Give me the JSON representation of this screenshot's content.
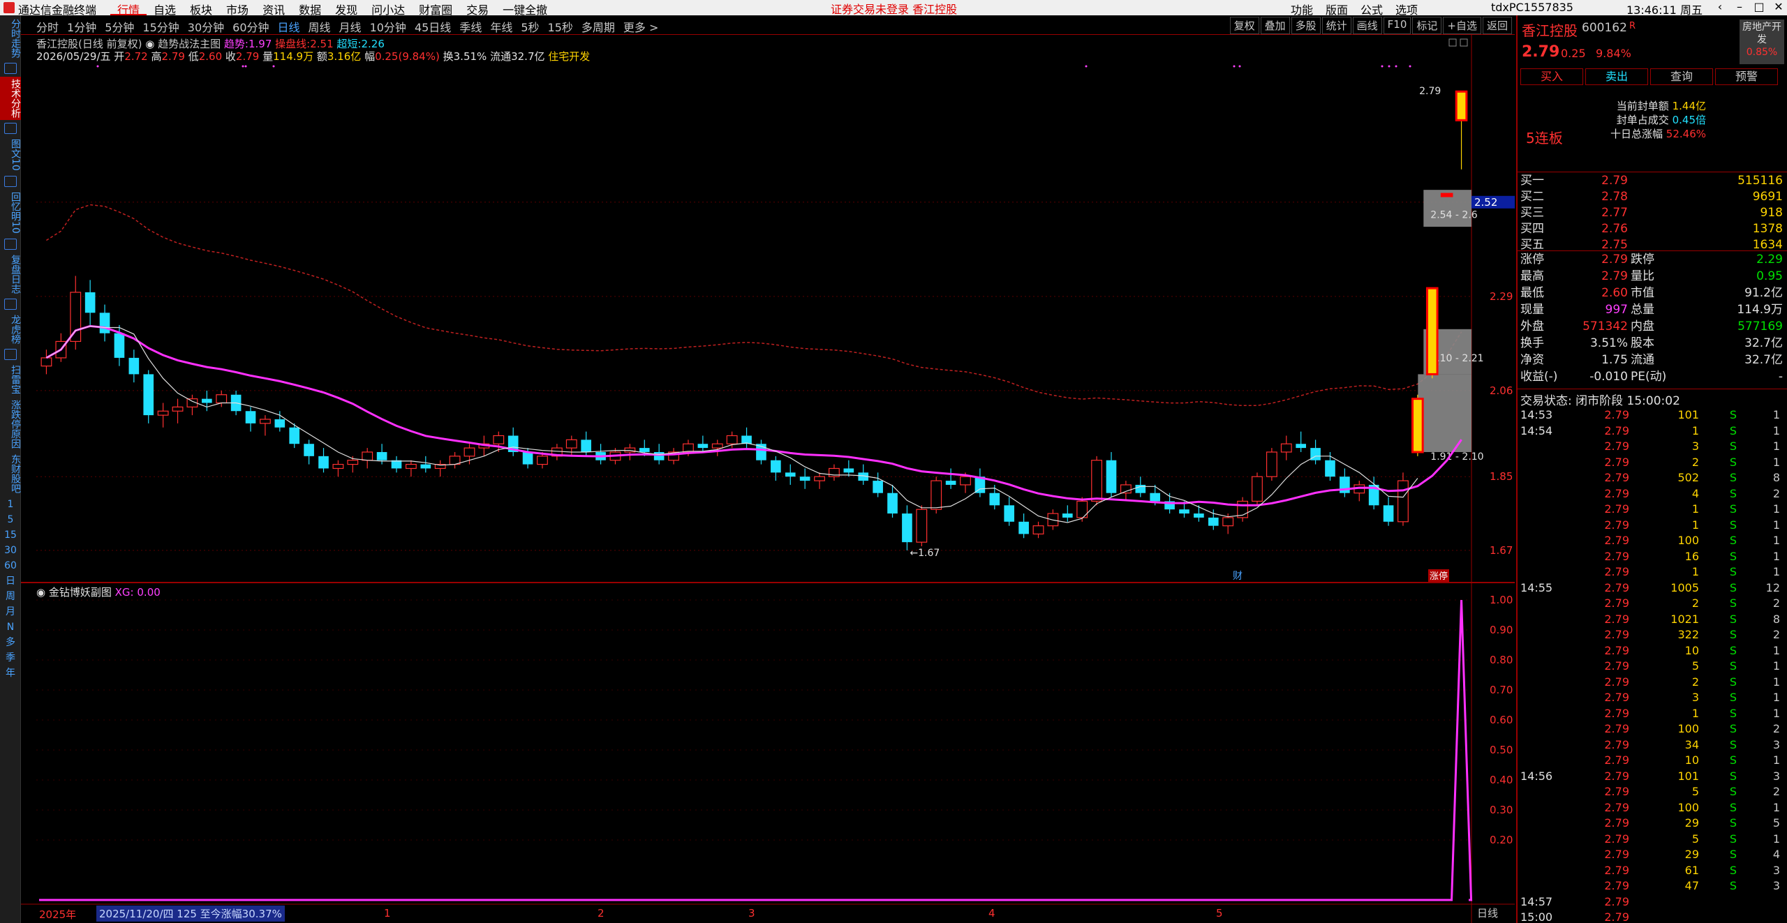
{
  "app": {
    "name": "通达信金融终端"
  },
  "menu": {
    "items": [
      "行情",
      "自选",
      "板块",
      "市场",
      "资讯",
      "数据",
      "发现",
      "问小达",
      "财富圈",
      "交易",
      "一键全撤"
    ],
    "active": "行情",
    "notice": "证券交易未登录  香江控股",
    "right_items": [
      "功能",
      "版面",
      "公式",
      "选项"
    ],
    "client_id": "tdxPC1557835",
    "time": "13:46:11 周五"
  },
  "left_toolbar": {
    "tabs": [
      "分时走势",
      "技术分析",
      "图文10",
      "回忆明10",
      "复盘日志",
      "龙虎榜",
      "扫雷宝",
      "涨跌停原因",
      "东财股吧"
    ],
    "active": "技术分析",
    "periods": [
      "1",
      "5",
      "15",
      "30",
      "60",
      "日",
      "周",
      "月",
      "N",
      "多",
      "季",
      "年"
    ]
  },
  "period_bar": {
    "items": [
      "分时",
      "1分钟",
      "5分钟",
      "15分钟",
      "30分钟",
      "60分钟",
      "日线",
      "周线",
      "月线",
      "10分钟",
      "45日线",
      "季线",
      "年线",
      "5秒",
      "15秒",
      "多周期",
      "更多 >"
    ],
    "selected": "日线",
    "buttons": [
      "复权",
      "叠加",
      "多股",
      "统计",
      "画线",
      "F10",
      "标记",
      "+自选",
      "返回"
    ]
  },
  "main_chart": {
    "title": "香江控股(日线 前复权)",
    "indicator_name": "趋势战法主图",
    "ind_trend_label": "趋势:",
    "ind_trend_val": "1.97",
    "ind_ctrl_label": "操盘线:",
    "ind_ctrl_val": "2.51",
    "ind_short_label": "超短:",
    "ind_short_val": "2.26",
    "date": "2026/05/29/五",
    "open_label": "开",
    "open": "2.72",
    "high_label": "高",
    "high": "2.79",
    "low_label": "低",
    "low": "2.60",
    "close_label": "收",
    "close": "2.79",
    "vol_label": "量",
    "vol": "114.9万",
    "amt_label": "额",
    "amt": "3.16亿",
    "chg_label": "幅",
    "chg": "0.25(9.84%)",
    "turn_label": "换",
    "turn": "3.51%",
    "float_label": "流通",
    "float": "32.7亿",
    "sector": "住宅开发",
    "price_ticks": [
      "2.52",
      "2.29",
      "2.06",
      "1.85",
      "1.67"
    ],
    "current_price_tag": "2.52",
    "label_high": "2.79",
    "label_low": "1.67",
    "zone_labels": [
      "2.54 - 2.6",
      "2.10 - 2.21",
      "1.91 - 2.10"
    ],
    "tag_cai": "财",
    "tag_zt": "涨停"
  },
  "sub_chart": {
    "title": "金钻博妖副图",
    "val_label": "XG:",
    "val": "0.00",
    "y_ticks": [
      "1.00",
      "0.90",
      "0.80",
      "0.70",
      "0.60",
      "0.50",
      "0.40",
      "0.30",
      "0.20"
    ]
  },
  "date_axis": {
    "year": "2025年",
    "range": "2025/11/20/四 125 至今涨幅30.37%",
    "months": [
      "1",
      "2",
      "3",
      "4",
      "5"
    ],
    "tab": "日线"
  },
  "chart_data": {
    "type": "candlestick",
    "title": "香江控股(日线 前复权)",
    "ylim": [
      1.6,
      2.85
    ],
    "candles": [
      [
        2.12,
        2.16,
        2.1,
        2.14
      ],
      [
        2.14,
        2.2,
        2.13,
        2.18
      ],
      [
        2.18,
        2.34,
        2.16,
        2.3
      ],
      [
        2.3,
        2.33,
        2.22,
        2.25
      ],
      [
        2.25,
        2.27,
        2.18,
        2.2
      ],
      [
        2.2,
        2.22,
        2.12,
        2.14
      ],
      [
        2.14,
        2.16,
        2.08,
        2.1
      ],
      [
        2.1,
        2.11,
        1.98,
        2.0
      ],
      [
        2.0,
        2.03,
        1.97,
        2.01
      ],
      [
        2.01,
        2.04,
        1.98,
        2.02
      ],
      [
        2.02,
        2.05,
        2.0,
        2.04
      ],
      [
        2.04,
        2.06,
        2.01,
        2.03
      ],
      [
        2.03,
        2.06,
        2.02,
        2.05
      ],
      [
        2.05,
        2.06,
        2.0,
        2.01
      ],
      [
        2.01,
        2.02,
        1.96,
        1.98
      ],
      [
        1.98,
        2.0,
        1.95,
        1.99
      ],
      [
        1.99,
        2.01,
        1.96,
        1.97
      ],
      [
        1.97,
        1.98,
        1.92,
        1.93
      ],
      [
        1.93,
        1.94,
        1.88,
        1.9
      ],
      [
        1.9,
        1.92,
        1.86,
        1.87
      ],
      [
        1.87,
        1.89,
        1.85,
        1.88
      ],
      [
        1.88,
        1.9,
        1.86,
        1.89
      ],
      [
        1.89,
        1.92,
        1.87,
        1.91
      ],
      [
        1.91,
        1.93,
        1.88,
        1.89
      ],
      [
        1.89,
        1.9,
        1.86,
        1.87
      ],
      [
        1.87,
        1.89,
        1.85,
        1.88
      ],
      [
        1.88,
        1.9,
        1.86,
        1.87
      ],
      [
        1.87,
        1.89,
        1.85,
        1.88
      ],
      [
        1.88,
        1.91,
        1.87,
        1.9
      ],
      [
        1.9,
        1.93,
        1.88,
        1.92
      ],
      [
        1.92,
        1.95,
        1.9,
        1.93
      ],
      [
        1.93,
        1.96,
        1.91,
        1.95
      ],
      [
        1.95,
        1.97,
        1.9,
        1.91
      ],
      [
        1.91,
        1.92,
        1.87,
        1.88
      ],
      [
        1.88,
        1.91,
        1.87,
        1.9
      ],
      [
        1.9,
        1.93,
        1.89,
        1.92
      ],
      [
        1.92,
        1.95,
        1.9,
        1.94
      ],
      [
        1.94,
        1.96,
        1.9,
        1.91
      ],
      [
        1.91,
        1.93,
        1.88,
        1.89
      ],
      [
        1.89,
        1.92,
        1.88,
        1.91
      ],
      [
        1.91,
        1.93,
        1.89,
        1.92
      ],
      [
        1.92,
        1.94,
        1.9,
        1.91
      ],
      [
        1.91,
        1.93,
        1.88,
        1.89
      ],
      [
        1.89,
        1.92,
        1.88,
        1.91
      ],
      [
        1.91,
        1.94,
        1.9,
        1.93
      ],
      [
        1.93,
        1.95,
        1.91,
        1.92
      ],
      [
        1.92,
        1.94,
        1.9,
        1.93
      ],
      [
        1.93,
        1.96,
        1.92,
        1.95
      ],
      [
        1.95,
        1.97,
        1.92,
        1.93
      ],
      [
        1.93,
        1.94,
        1.88,
        1.89
      ],
      [
        1.89,
        1.9,
        1.84,
        1.86
      ],
      [
        1.86,
        1.88,
        1.83,
        1.85
      ],
      [
        1.85,
        1.87,
        1.82,
        1.84
      ],
      [
        1.84,
        1.86,
        1.82,
        1.85
      ],
      [
        1.85,
        1.88,
        1.84,
        1.87
      ],
      [
        1.87,
        1.89,
        1.85,
        1.86
      ],
      [
        1.86,
        1.88,
        1.83,
        1.84
      ],
      [
        1.84,
        1.86,
        1.8,
        1.81
      ],
      [
        1.81,
        1.83,
        1.75,
        1.76
      ],
      [
        1.76,
        1.78,
        1.67,
        1.69
      ],
      [
        1.69,
        1.78,
        1.68,
        1.77
      ],
      [
        1.77,
        1.85,
        1.76,
        1.84
      ],
      [
        1.84,
        1.87,
        1.82,
        1.83
      ],
      [
        1.83,
        1.86,
        1.81,
        1.85
      ],
      [
        1.85,
        1.87,
        1.8,
        1.81
      ],
      [
        1.81,
        1.83,
        1.77,
        1.78
      ],
      [
        1.78,
        1.8,
        1.73,
        1.74
      ],
      [
        1.74,
        1.76,
        1.7,
        1.71
      ],
      [
        1.71,
        1.74,
        1.7,
        1.73
      ],
      [
        1.73,
        1.77,
        1.72,
        1.76
      ],
      [
        1.76,
        1.78,
        1.74,
        1.75
      ],
      [
        1.75,
        1.8,
        1.74,
        1.79
      ],
      [
        1.79,
        1.9,
        1.78,
        1.89
      ],
      [
        1.89,
        1.91,
        1.8,
        1.81
      ],
      [
        1.81,
        1.84,
        1.79,
        1.83
      ],
      [
        1.83,
        1.85,
        1.8,
        1.81
      ],
      [
        1.81,
        1.83,
        1.78,
        1.79
      ],
      [
        1.79,
        1.81,
        1.76,
        1.77
      ],
      [
        1.77,
        1.79,
        1.75,
        1.76
      ],
      [
        1.76,
        1.78,
        1.74,
        1.75
      ],
      [
        1.75,
        1.77,
        1.72,
        1.73
      ],
      [
        1.73,
        1.76,
        1.71,
        1.75
      ],
      [
        1.75,
        1.8,
        1.74,
        1.79
      ],
      [
        1.79,
        1.86,
        1.78,
        1.85
      ],
      [
        1.85,
        1.92,
        1.84,
        1.91
      ],
      [
        1.91,
        1.95,
        1.89,
        1.93
      ],
      [
        1.93,
        1.96,
        1.91,
        1.92
      ],
      [
        1.92,
        1.94,
        1.88,
        1.89
      ],
      [
        1.89,
        1.91,
        1.84,
        1.85
      ],
      [
        1.85,
        1.87,
        1.8,
        1.81
      ],
      [
        1.81,
        1.84,
        1.79,
        1.83
      ],
      [
        1.83,
        1.85,
        1.77,
        1.78
      ],
      [
        1.78,
        1.8,
        1.73,
        1.74
      ],
      [
        1.74,
        1.86,
        1.73,
        1.84
      ],
      [
        1.91,
        2.05,
        1.9,
        2.04
      ],
      [
        2.1,
        2.31,
        2.09,
        2.31
      ],
      [
        2.54,
        2.54,
        2.54,
        2.54
      ],
      [
        2.72,
        2.79,
        2.6,
        2.79
      ]
    ],
    "series": [
      {
        "name": "操盘线",
        "values_hint": "magenta moving average"
      },
      {
        "name": "超短",
        "values_hint": "white short average"
      }
    ],
    "sub_series": {
      "name": "XG",
      "range": [
        0,
        1
      ],
      "spike_at_end": 1.0
    }
  },
  "right_panel": {
    "name": "香江控股",
    "code": "600162",
    "r_mark": "R",
    "price": "2.79",
    "change": "0.25",
    "change_pct": "9.84%",
    "sector_name": "房地产开发",
    "sector_pct": "0.85%",
    "buttons": [
      "买入",
      "卖出",
      "查询",
      "预警"
    ],
    "seal_amount_label": "当前封单额",
    "seal_amount": "1.44亿",
    "seal_ratio_label": "封单占成交",
    "seal_ratio": "0.45倍",
    "ten_day_label": "十日总涨幅",
    "ten_day": "52.46%",
    "lianban": "5连板",
    "bids": [
      {
        "k": "买一",
        "p": "2.79",
        "v": "515116"
      },
      {
        "k": "买二",
        "p": "2.78",
        "v": "9691"
      },
      {
        "k": "买三",
        "p": "2.77",
        "v": "918"
      },
      {
        "k": "买四",
        "p": "2.76",
        "v": "1378"
      },
      {
        "k": "买五",
        "p": "2.75",
        "v": "1634"
      }
    ],
    "stats": [
      {
        "k1": "涨停",
        "v1": "2.79",
        "c1": "red",
        "k2": "跌停",
        "v2": "2.29",
        "c2": "grn"
      },
      {
        "k1": "最高",
        "v1": "2.79",
        "c1": "red",
        "k2": "量比",
        "v2": "0.95",
        "c2": "grn"
      },
      {
        "k1": "最低",
        "v1": "2.60",
        "c1": "red",
        "k2": "市值",
        "v2": "91.2亿",
        "c2": "wh"
      },
      {
        "k1": "现量",
        "v1": "997",
        "c1": "mag",
        "k2": "总量",
        "v2": "114.9万",
        "c2": "wh"
      },
      {
        "k1": "外盘",
        "v1": "571342",
        "c1": "red",
        "k2": "内盘",
        "v2": "577169",
        "c2": "grn"
      },
      {
        "k1": "换手",
        "v1": "3.51%",
        "c1": "wh",
        "k2": "股本",
        "v2": "32.7亿",
        "c2": "wh"
      },
      {
        "k1": "净资",
        "v1": "1.75",
        "c1": "wh",
        "k2": "流通",
        "v2": "32.7亿",
        "c2": "wh"
      },
      {
        "k1": "收益(-)",
        "v1": "-0.010",
        "c1": "wh",
        "k2": "PE(动)",
        "v2": "-",
        "c2": "wh"
      }
    ],
    "trade_state": "交易状态: 闭市阶段 15:00:02",
    "ticks": [
      {
        "t": "14:53",
        "p": "2.79",
        "v": "101",
        "s": "S",
        "n": "1"
      },
      {
        "t": "14:54",
        "p": "2.79",
        "v": "1",
        "s": "S",
        "n": "1"
      },
      {
        "t": "",
        "p": "2.79",
        "v": "3",
        "s": "S",
        "n": "1"
      },
      {
        "t": "",
        "p": "2.79",
        "v": "2",
        "s": "S",
        "n": "1"
      },
      {
        "t": "",
        "p": "2.79",
        "v": "502",
        "s": "S",
        "n": "8"
      },
      {
        "t": "",
        "p": "2.79",
        "v": "4",
        "s": "S",
        "n": "2"
      },
      {
        "t": "",
        "p": "2.79",
        "v": "1",
        "s": "S",
        "n": "1"
      },
      {
        "t": "",
        "p": "2.79",
        "v": "1",
        "s": "S",
        "n": "1"
      },
      {
        "t": "",
        "p": "2.79",
        "v": "100",
        "s": "S",
        "n": "1"
      },
      {
        "t": "",
        "p": "2.79",
        "v": "16",
        "s": "S",
        "n": "1"
      },
      {
        "t": "",
        "p": "2.79",
        "v": "1",
        "s": "S",
        "n": "1"
      },
      {
        "t": "14:55",
        "p": "2.79",
        "v": "1005",
        "s": "S",
        "n": "12"
      },
      {
        "t": "",
        "p": "2.79",
        "v": "2",
        "s": "S",
        "n": "2"
      },
      {
        "t": "",
        "p": "2.79",
        "v": "1021",
        "s": "S",
        "n": "8"
      },
      {
        "t": "",
        "p": "2.79",
        "v": "322",
        "s": "S",
        "n": "2"
      },
      {
        "t": "",
        "p": "2.79",
        "v": "10",
        "s": "S",
        "n": "1"
      },
      {
        "t": "",
        "p": "2.79",
        "v": "5",
        "s": "S",
        "n": "1"
      },
      {
        "t": "",
        "p": "2.79",
        "v": "2",
        "s": "S",
        "n": "1"
      },
      {
        "t": "",
        "p": "2.79",
        "v": "3",
        "s": "S",
        "n": "1"
      },
      {
        "t": "",
        "p": "2.79",
        "v": "1",
        "s": "S",
        "n": "1"
      },
      {
        "t": "",
        "p": "2.79",
        "v": "100",
        "s": "S",
        "n": "2"
      },
      {
        "t": "",
        "p": "2.79",
        "v": "34",
        "s": "S",
        "n": "3"
      },
      {
        "t": "",
        "p": "2.79",
        "v": "10",
        "s": "S",
        "n": "1"
      },
      {
        "t": "14:56",
        "p": "2.79",
        "v": "101",
        "s": "S",
        "n": "3"
      },
      {
        "t": "",
        "p": "2.79",
        "v": "5",
        "s": "S",
        "n": "2"
      },
      {
        "t": "",
        "p": "2.79",
        "v": "100",
        "s": "S",
        "n": "1"
      },
      {
        "t": "",
        "p": "2.79",
        "v": "29",
        "s": "S",
        "n": "5"
      },
      {
        "t": "",
        "p": "2.79",
        "v": "5",
        "s": "S",
        "n": "1"
      },
      {
        "t": "",
        "p": "2.79",
        "v": "29",
        "s": "S",
        "n": "4"
      },
      {
        "t": "",
        "p": "2.79",
        "v": "61",
        "s": "S",
        "n": "3"
      },
      {
        "t": "",
        "p": "2.79",
        "v": "47",
        "s": "S",
        "n": "3"
      },
      {
        "t": "14:57",
        "p": "2.79",
        "v": "",
        "s": "",
        "n": ""
      },
      {
        "t": "15:00",
        "p": "2.79",
        "v": "",
        "s": "",
        "n": ""
      }
    ]
  }
}
